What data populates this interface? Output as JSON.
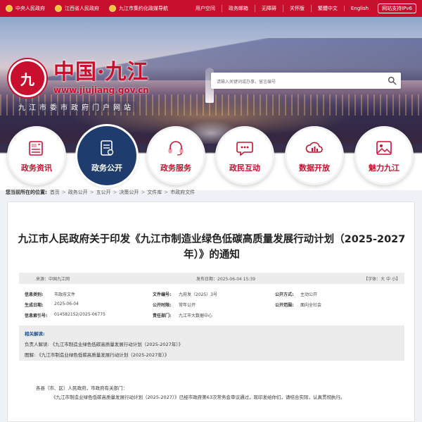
{
  "topbar": {
    "links_left": [
      "中央人民政府",
      "江西省人民政府",
      "九江市集约化政媒导航"
    ],
    "links_right": [
      "用户空间",
      "政务邮箱",
      "无障碍",
      "关怀版",
      "繁體中文",
      "English"
    ],
    "ipv6": "网站支持IPv6"
  },
  "header": {
    "logo_title": "中国·九江",
    "logo_url": "www.jiujiang.gov.cn",
    "logo_sub": "九江市委市政府门户网站",
    "search_placeholder": "请输入关键词或办事，留言编号"
  },
  "nav": {
    "items": [
      {
        "label": "政务资讯",
        "icon": "newspaper-icon"
      },
      {
        "label": "政务公开",
        "icon": "document-icon",
        "active": true
      },
      {
        "label": "政务服务",
        "icon": "headset-icon"
      },
      {
        "label": "政民互动",
        "icon": "chat-icon"
      },
      {
        "label": "数据开放",
        "icon": "cloud-chart-icon"
      },
      {
        "label": "魅力九江",
        "icon": "image-icon"
      }
    ]
  },
  "breadcrumb": {
    "label": "您当前所在的位置:",
    "items": [
      "首页",
      "政务公开",
      "五公开",
      "决策公开",
      "文件库",
      "市政府文件"
    ],
    "separator": ">"
  },
  "document": {
    "title": "九江市人民政府关于印发《九江市制造业绿色低碳高质量发展行动计划（2025-2027年）》的通知",
    "source": "来源：中国九江网",
    "publish_date": "发布日期：2025-06-04 15:39",
    "font_size": "【字体：大 中 小】",
    "meta": {
      "category_label": "信息类别:",
      "category": "市政府文件",
      "doc_no_label": "文件编号:",
      "doc_no": "九府发（2025）3号",
      "open_method_label": "公开方式:",
      "open_method": "主动公开",
      "created_label": "生成日期:",
      "created": "2025-06-04",
      "open_time_label": "公开时限:",
      "open_time": "常年公开",
      "open_scope_label": "公开范围:",
      "open_scope": "面向全社会",
      "index_label": "信息索引号:",
      "index": "014582152/2025-06775",
      "dept_label": "责任部门:",
      "dept": "九江市大数据中心"
    },
    "interpretation": {
      "heading": "相关解读:",
      "line1_label": "负责人解读:",
      "line1_value": "《九江市制造业绿色低碳高质量发展行动计划（2025-2027年）》",
      "line2_label": "图解:",
      "line2_value": "《九江市制造业绿色低碳高质量发展行动计划（2025-2027年）》"
    },
    "body": {
      "greeting": "各县（市、区）人民政府，市政府有关部门：",
      "paragraph": "《九江市制造业绿色低碳高质量发展行动计划（2025-2027）》已经市政府第63次常务会审议通过，现印发给你们，请结合实际，认真贯彻执行。"
    }
  },
  "colors": {
    "brand_red": "#c8102e",
    "navy": "#1e3d6e"
  }
}
